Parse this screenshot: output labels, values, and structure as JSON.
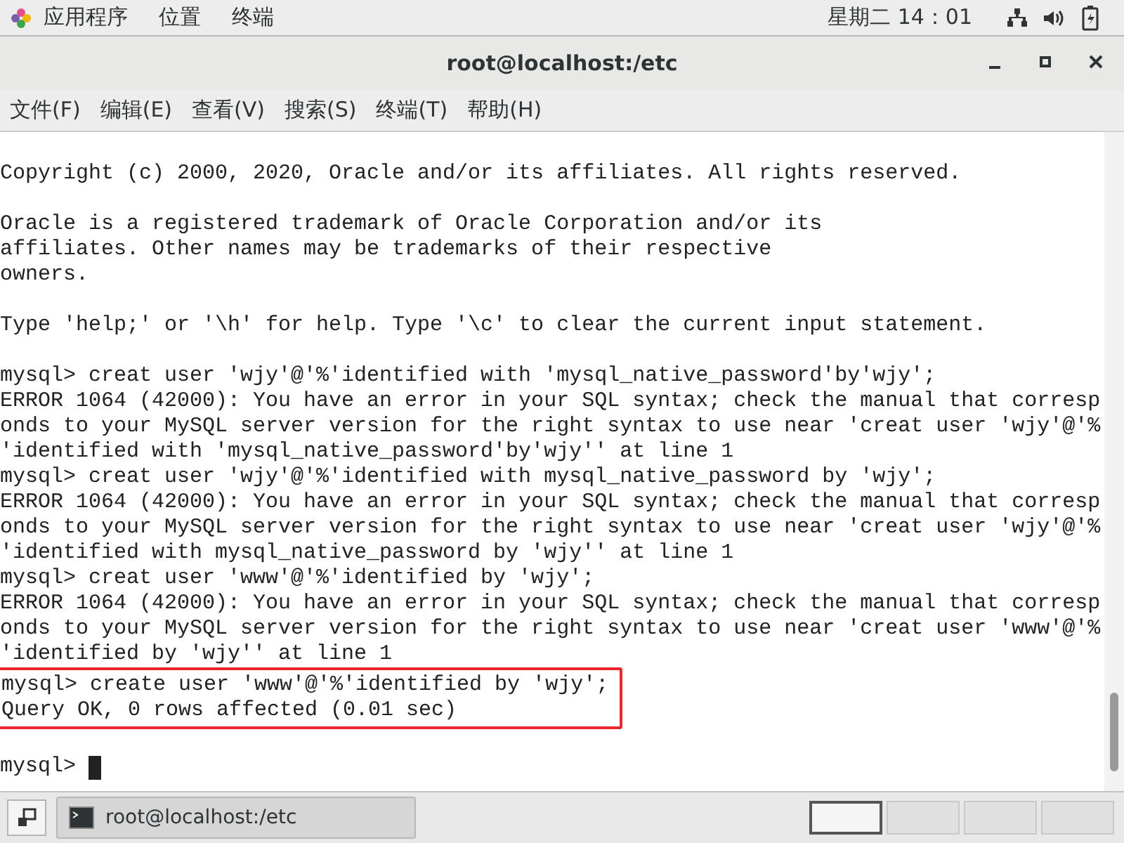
{
  "top_bar": {
    "menus": [
      "应用程序",
      "位置",
      "终端"
    ],
    "clock": "星期二 14：01"
  },
  "window": {
    "title": "root@localhost:/etc"
  },
  "menu_bar": [
    "文件(F)",
    "编辑(E)",
    "查看(V)",
    "搜索(S)",
    "终端(T)",
    "帮助(H)"
  ],
  "terminal": {
    "lines": [
      {
        "kind": "blank"
      },
      {
        "kind": "text",
        "text": "Copyright (c) 2000, 2020, Oracle and/or its affiliates. All rights reserved."
      },
      {
        "kind": "blank"
      },
      {
        "kind": "text",
        "text": "Oracle is a registered trademark of Oracle Corporation and/or its"
      },
      {
        "kind": "text",
        "text": "affiliates. Other names may be trademarks of their respective"
      },
      {
        "kind": "text",
        "text": "owners."
      },
      {
        "kind": "blank"
      },
      {
        "kind": "text",
        "text": "Type 'help;' or '\\h' for help. Type '\\c' to clear the current input statement."
      },
      {
        "kind": "blank"
      },
      {
        "kind": "text",
        "text": "mysql> creat user 'wjy'@'%'identified with 'mysql_native_password'by'wjy';"
      },
      {
        "kind": "text",
        "text": "ERROR 1064 (42000): You have an error in your SQL syntax; check the manual that corresp"
      },
      {
        "kind": "text",
        "text": "onds to your MySQL server version for the right syntax to use near 'creat user 'wjy'@'%"
      },
      {
        "kind": "text",
        "text": "'identified with 'mysql_native_password'by'wjy'' at line 1"
      },
      {
        "kind": "text",
        "text": "mysql> creat user 'wjy'@'%'identified with mysql_native_password by 'wjy';"
      },
      {
        "kind": "text",
        "text": "ERROR 1064 (42000): You have an error in your SQL syntax; check the manual that corresp"
      },
      {
        "kind": "text",
        "text": "onds to your MySQL server version for the right syntax to use near 'creat user 'wjy'@'%"
      },
      {
        "kind": "text",
        "text": "'identified with mysql_native_password by 'wjy'' at line 1"
      },
      {
        "kind": "text",
        "text": "mysql> creat user 'www'@'%'identified by 'wjy';"
      },
      {
        "kind": "text",
        "text": "ERROR 1064 (42000): You have an error in your SQL syntax; check the manual that corresp"
      },
      {
        "kind": "text",
        "text": "onds to your MySQL server version for the right syntax to use near 'creat user 'www'@'%"
      },
      {
        "kind": "text",
        "text": "'identified by 'wjy'' at line 1"
      }
    ],
    "highlighted_lines": [
      "mysql> create user 'www'@'%'identified by 'wjy';",
      "Query OK, 0 rows affected (0.01 sec)"
    ],
    "lines_after": [
      {
        "kind": "blank"
      },
      {
        "kind": "prompt",
        "text": "mysql> "
      }
    ]
  },
  "taskbar": {
    "task": "root@localhost:/etc"
  }
}
